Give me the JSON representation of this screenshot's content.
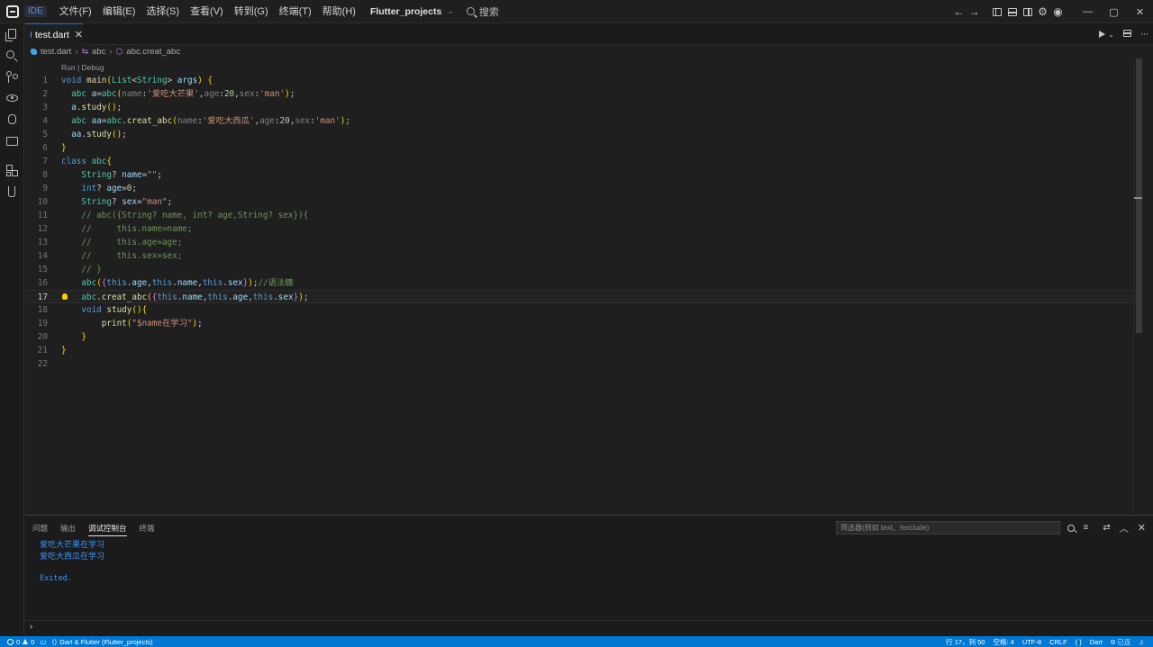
{
  "titlebar": {
    "ide_badge": "IDE",
    "menus": [
      "文件(F)",
      "编辑(E)",
      "选择(S)",
      "查看(V)",
      "转到(G)",
      "终端(T)",
      "帮助(H)"
    ],
    "project": "Flutter_projects",
    "search_label": "搜索",
    "window_controls": [
      "—",
      "▢",
      "✕"
    ]
  },
  "tabs": [
    {
      "label": "test.dart",
      "icon": "dart-icon",
      "active": true
    }
  ],
  "breadcrumb": {
    "file": "test.dart",
    "class": "abc",
    "method": "abc.creat_abc"
  },
  "editor": {
    "codelens": "Run | Debug",
    "current_line": 17,
    "lines": [
      "void main(List<String> args) {",
      "  abc a=abc(name:'爱吃大芒果',age:20,sex:'man');",
      "  a.study();",
      "  abc aa=abc.creat_abc(name:'爱吃大西瓜',age:20,sex:'man');",
      "  aa.study();",
      "}",
      "class abc{",
      "    String? name=\"\";",
      "    int? age=0;",
      "    String? sex=\"man\";",
      "    // abc({String? name, int? age,String? sex}){",
      "    //     this.name=name;",
      "    //     this.age=age;",
      "    //     this.sex=sex;",
      "    // }",
      "    abc({this.age,this.name,this.sex});//语法糖",
      "    abc.creat_abc({this.name,this.age,this.sex});",
      "    void study(){",
      "        print(\"$name在学习\");",
      "    }",
      "}",
      ""
    ]
  },
  "panel": {
    "tabs": [
      "问题",
      "输出",
      "调试控制台",
      "终端"
    ],
    "active_tab": "调试控制台",
    "filter_placeholder": "筛选器(例如 text、!exclude)",
    "output": [
      "爱吃大芒果在学习",
      "爱吃大西瓜在学习",
      "",
      "Exited."
    ],
    "prompt": "›"
  },
  "statusbar": {
    "errors": "0",
    "warnings": "0",
    "sdk": "Dart & Flutter (Flutter_projects)",
    "position": "行 17，列 50",
    "indent": "空格: 4",
    "encoding": "UTF-8",
    "eol": "CRLF",
    "braces": "{ }",
    "language": "Dart",
    "extra": "⧉ 已连"
  },
  "colors": {
    "accent": "#0078d4",
    "console_text": "#3794ff",
    "editor_bg": "#1f1f1f"
  }
}
